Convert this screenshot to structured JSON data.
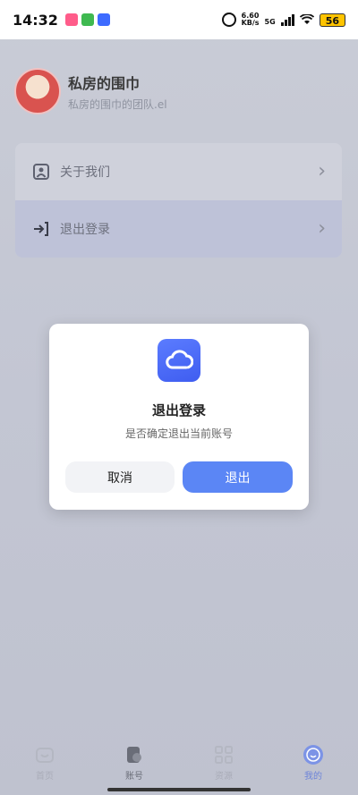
{
  "status_bar": {
    "time": "14:32",
    "net_speed_value": "6.60",
    "net_speed_unit": "KB/s",
    "network_type": "5G",
    "battery": "56"
  },
  "profile": {
    "name": "私房的围巾",
    "subtitle": "私房的围巾的团队.el"
  },
  "menu": {
    "items": [
      {
        "label": "关于我们",
        "icon": "about-us-icon"
      },
      {
        "label": "退出登录",
        "icon": "logout-icon"
      }
    ]
  },
  "dialog": {
    "title": "退出登录",
    "message": "是否确定退出当前账号",
    "cancel_label": "取消",
    "confirm_label": "退出"
  },
  "bottom_nav": {
    "items": [
      {
        "label": "首页",
        "icon": "home-icon"
      },
      {
        "label": "账号",
        "icon": "account-icon"
      },
      {
        "label": "资源",
        "icon": "resources-icon"
      },
      {
        "label": "我的",
        "icon": "profile-icon"
      }
    ]
  },
  "colors": {
    "accent": "#5b86f5",
    "logo": "#4a68f5",
    "battery": "#ffc400"
  }
}
